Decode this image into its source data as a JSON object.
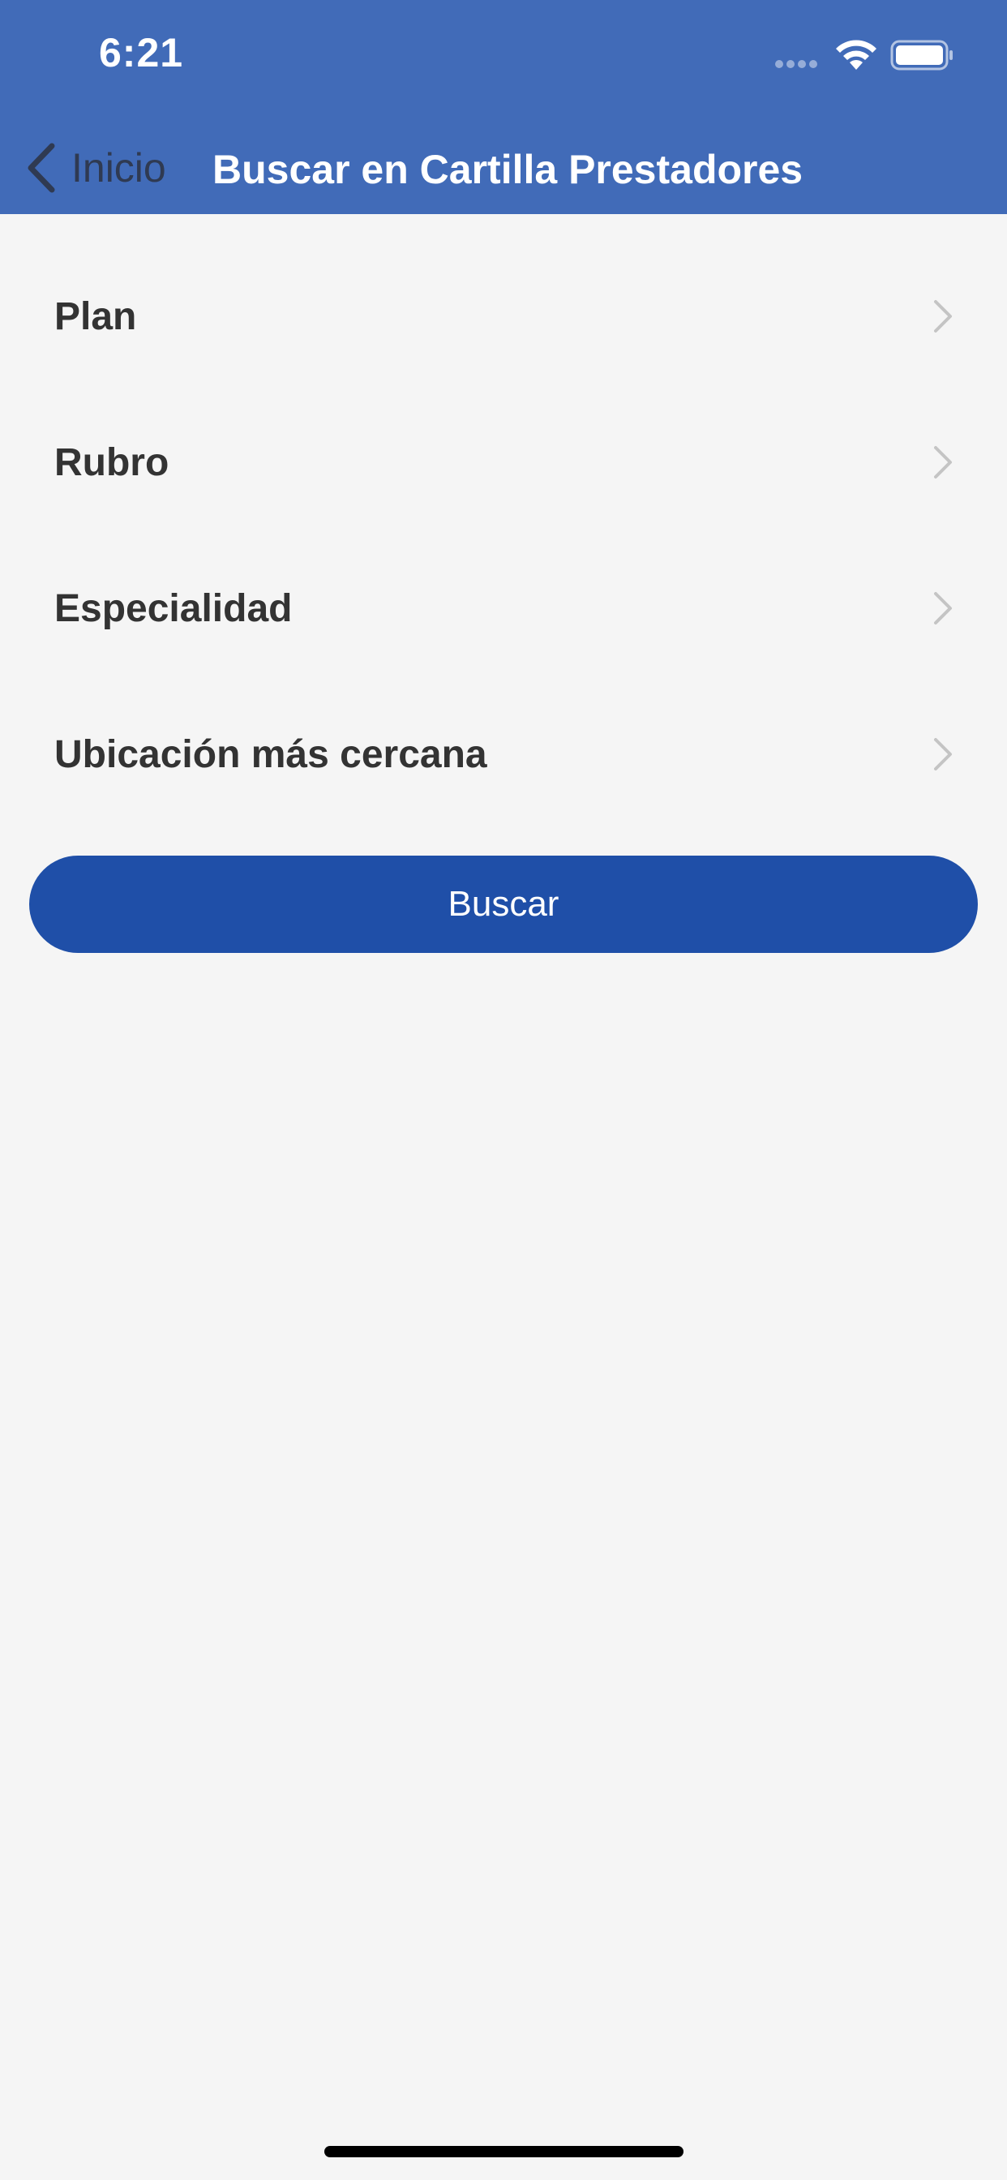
{
  "status_bar": {
    "time": "6:21",
    "icons": [
      "signal-icon",
      "wifi-icon",
      "battery-icon"
    ]
  },
  "nav": {
    "back_label": "Inicio",
    "title": "Buscar en Cartilla Prestadores"
  },
  "rows": [
    {
      "label": "Plan"
    },
    {
      "label": "Rubro"
    },
    {
      "label": "Especialidad"
    },
    {
      "label": "Ubicación más cercana"
    }
  ],
  "actions": {
    "search_label": "Buscar"
  },
  "colors": {
    "header": "#416bb8",
    "button": "#1f4fa8",
    "background": "#f5f5f5",
    "row_text": "#333333",
    "chevron": "#c4c4c4"
  }
}
